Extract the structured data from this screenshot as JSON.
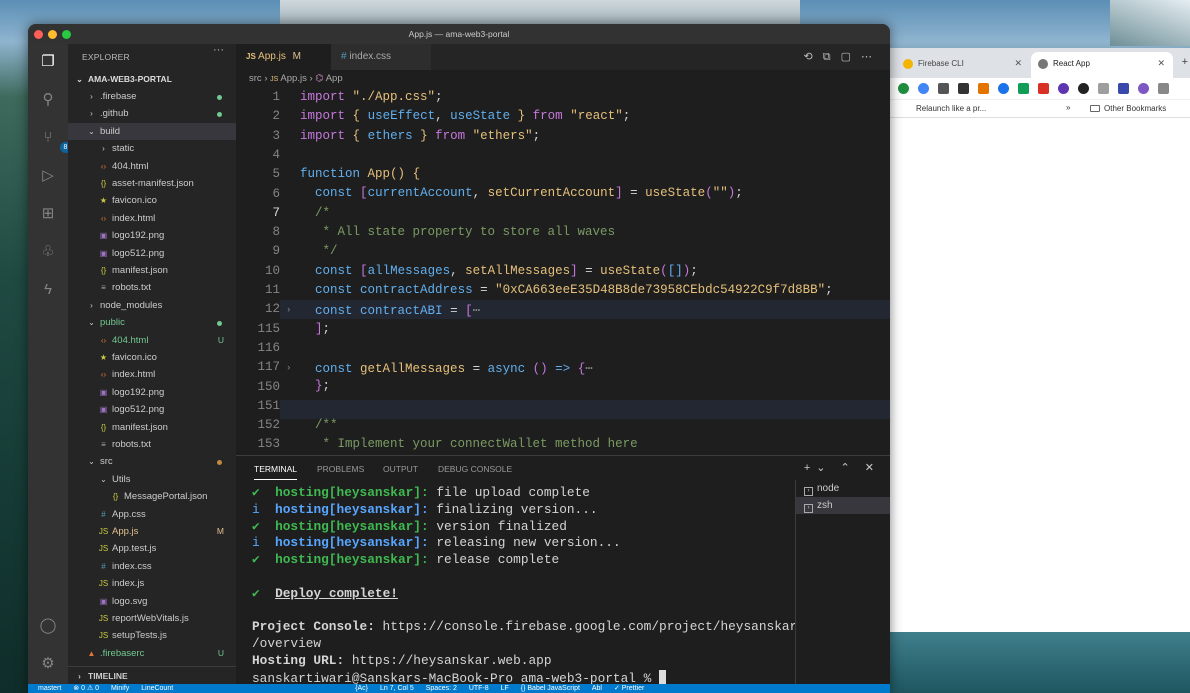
{
  "window": {
    "title": "App.js — ama-web3-portal"
  },
  "chrome": {
    "tabs": [
      {
        "label": "Firebase CLI"
      },
      {
        "label": "React App"
      }
    ],
    "bookmarks": {
      "item": "Relaunch like a pr...",
      "chevron": "»",
      "other": "Other Bookmarks"
    }
  },
  "explorer": {
    "header": "EXPLORER",
    "more": "···",
    "project": "AMA-WEB3-PORTAL",
    "items": [
      {
        "label": ".firebase",
        "type": "folder",
        "depth": 1,
        "status": "dot-green"
      },
      {
        "label": ".github",
        "type": "folder",
        "depth": 1,
        "status": "dot-green"
      },
      {
        "label": "build",
        "type": "folder-open",
        "depth": 1,
        "status": ""
      },
      {
        "label": "static",
        "type": "folder",
        "depth": 2,
        "status": ""
      },
      {
        "label": "404.html",
        "type": "html",
        "depth": 2,
        "status": ""
      },
      {
        "label": "asset-manifest.json",
        "type": "json",
        "depth": 2,
        "status": ""
      },
      {
        "label": "favicon.ico",
        "type": "star",
        "depth": 2,
        "status": ""
      },
      {
        "label": "index.html",
        "type": "html",
        "depth": 2,
        "status": ""
      },
      {
        "label": "logo192.png",
        "type": "img",
        "depth": 2,
        "status": ""
      },
      {
        "label": "logo512.png",
        "type": "img",
        "depth": 2,
        "status": ""
      },
      {
        "label": "manifest.json",
        "type": "json",
        "depth": 2,
        "status": ""
      },
      {
        "label": "robots.txt",
        "type": "txt",
        "depth": 2,
        "status": ""
      },
      {
        "label": "node_modules",
        "type": "folder",
        "depth": 1,
        "status": ""
      },
      {
        "label": "public",
        "type": "folder-open",
        "depth": 1,
        "status": "dot-green"
      },
      {
        "label": "404.html",
        "type": "html",
        "depth": 2,
        "status": "U"
      },
      {
        "label": "favicon.ico",
        "type": "star",
        "depth": 2,
        "status": ""
      },
      {
        "label": "index.html",
        "type": "html",
        "depth": 2,
        "status": ""
      },
      {
        "label": "logo192.png",
        "type": "img",
        "depth": 2,
        "status": ""
      },
      {
        "label": "logo512.png",
        "type": "img",
        "depth": 2,
        "status": ""
      },
      {
        "label": "manifest.json",
        "type": "json",
        "depth": 2,
        "status": ""
      },
      {
        "label": "robots.txt",
        "type": "txt",
        "depth": 2,
        "status": ""
      },
      {
        "label": "src",
        "type": "folder-open",
        "depth": 1,
        "status": "dot-orange"
      },
      {
        "label": "Utils",
        "type": "folder-open",
        "depth": 2,
        "status": ""
      },
      {
        "label": "MessagePortal.json",
        "type": "json",
        "depth": 3,
        "status": ""
      },
      {
        "label": "App.css",
        "type": "css",
        "depth": 2,
        "status": ""
      },
      {
        "label": "App.js",
        "type": "js",
        "depth": 2,
        "status": "M"
      },
      {
        "label": "App.test.js",
        "type": "test",
        "depth": 2,
        "status": ""
      },
      {
        "label": "index.css",
        "type": "css",
        "depth": 2,
        "status": ""
      },
      {
        "label": "index.js",
        "type": "js",
        "depth": 2,
        "status": ""
      },
      {
        "label": "logo.svg",
        "type": "img",
        "depth": 2,
        "status": ""
      },
      {
        "label": "reportWebVitals.js",
        "type": "js",
        "depth": 2,
        "status": ""
      },
      {
        "label": "setupTests.js",
        "type": "js",
        "depth": 2,
        "status": ""
      },
      {
        "label": ".firebaserc",
        "type": "fire",
        "depth": 1,
        "status": "U"
      }
    ],
    "timeline": "TIMELINE"
  },
  "activity": {
    "scm_badge": "8"
  },
  "editor": {
    "tabs": [
      {
        "label": "App.js",
        "mark": "M"
      },
      {
        "label": "index.css"
      }
    ],
    "breadcrumb": [
      "src",
      "App.js",
      "App"
    ],
    "line_numbers": [
      "1",
      "2",
      "3",
      "4",
      "5",
      "6",
      "7",
      "8",
      "9",
      "10",
      "11",
      "12",
      "115",
      "116",
      "117",
      "150",
      "151",
      "152",
      "153"
    ]
  },
  "panel": {
    "tabs": [
      "TERMINAL",
      "PROBLEMS",
      "OUTPUT",
      "DEBUG CONSOLE"
    ],
    "terminals": [
      "node",
      "zsh"
    ],
    "lines": [
      {
        "pre": "✔  ",
        "host": "hosting[heysanskar]:",
        "msg": " file upload complete",
        "kind": "ok"
      },
      {
        "pre": "i  ",
        "host": "hosting[heysanskar]:",
        "msg": " finalizing version...",
        "kind": "info"
      },
      {
        "pre": "✔  ",
        "host": "hosting[heysanskar]:",
        "msg": " version finalized",
        "kind": "ok"
      },
      {
        "pre": "i  ",
        "host": "hosting[heysanskar]:",
        "msg": " releasing new version...",
        "kind": "info"
      },
      {
        "pre": "✔  ",
        "host": "hosting[heysanskar]:",
        "msg": " release complete",
        "kind": "ok"
      }
    ],
    "deploy": "Deploy complete!",
    "console_label": "Project Console:",
    "console_url_1": " https://console.firebase.google.com/project/heysanskar",
    "console_url_2": "/overview",
    "hosting_label": "Hosting URL:",
    "hosting_url": " https://heysanskar.web.app",
    "prompt": "sanskartiwari@Sanskars-MacBook-Pro ama-web3-portal % "
  },
  "statusbar": {
    "branch": "mastert",
    "errors": "⊗ 0 ⚠ 0",
    "items": [
      "Minify",
      "LineCount",
      "{Ac}",
      "Ln 7, Col 5",
      "Spaces: 2",
      "UTF-8",
      "LF",
      "{} Babel JavaScript",
      "Abl",
      "✓ Prettier"
    ]
  }
}
